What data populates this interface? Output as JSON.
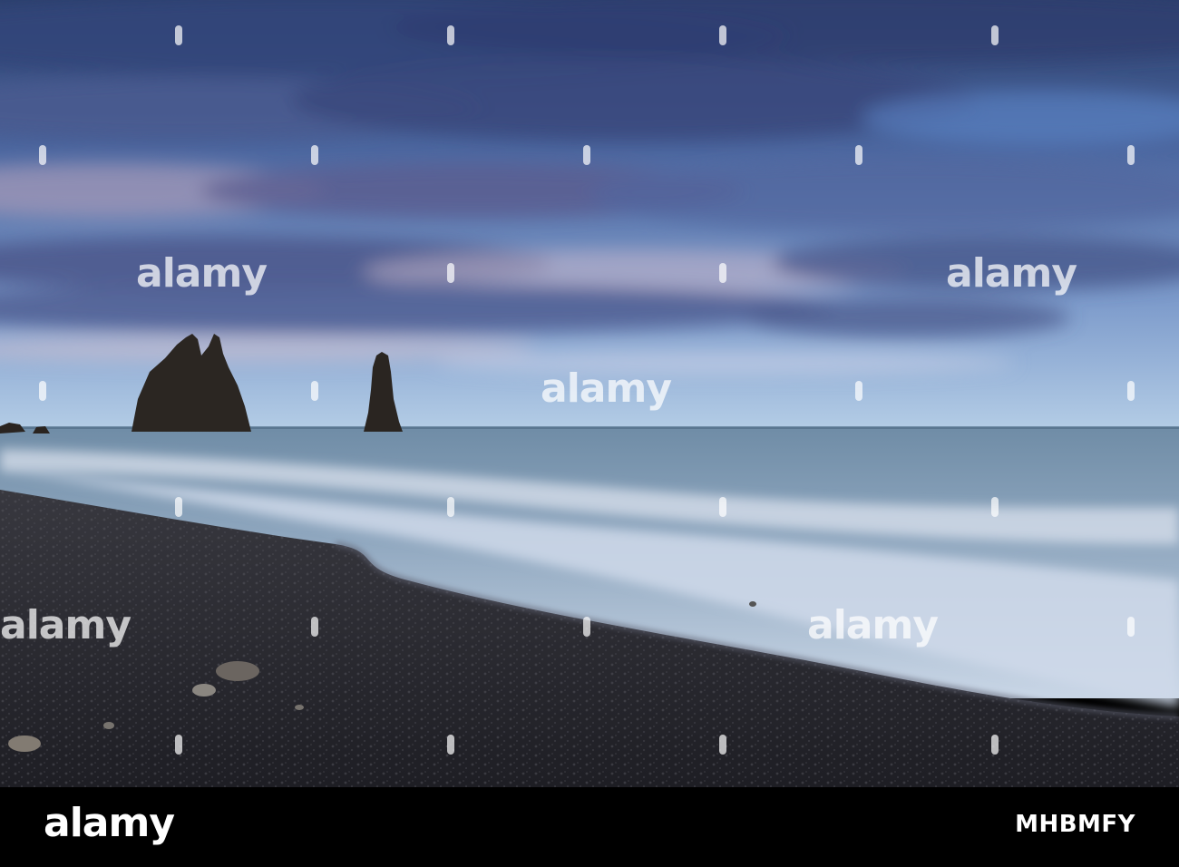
{
  "photo": {
    "subject": "",
    "colors": {
      "sky_top": "#2c4372",
      "sky_mid": "#5e7bb4",
      "sky_horizon": "#a9c6e6",
      "cloud": "#4d5a89",
      "cloud_light": "#c9b6cb",
      "sea": "#7f9ab0",
      "surf": "#d7e0ee",
      "sand": "#2a2a31",
      "rock": "#2b2622"
    }
  },
  "watermark": {
    "text": "alamy"
  },
  "footer": {
    "brand": "alamy",
    "stock_id": "MHBMFY"
  }
}
